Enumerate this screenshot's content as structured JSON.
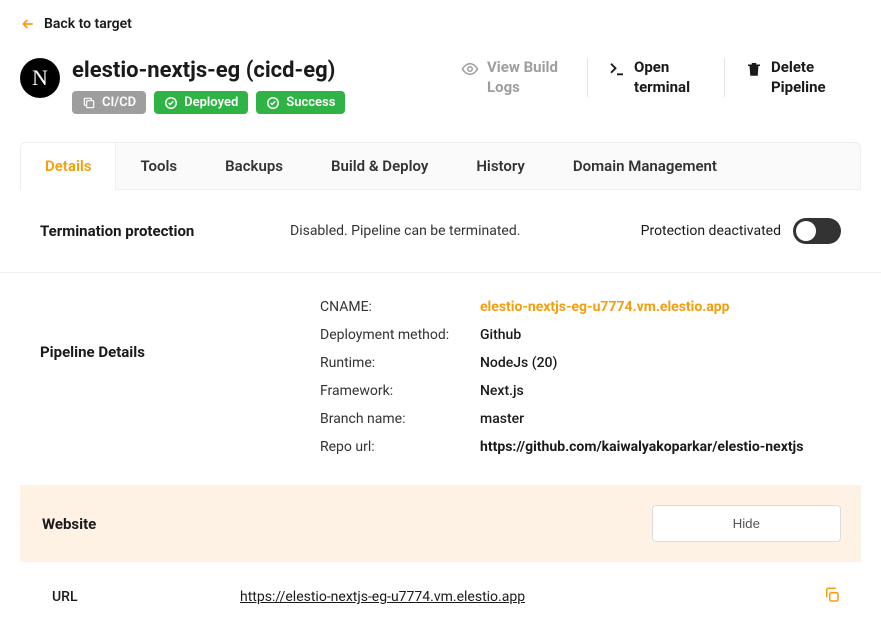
{
  "back_label": "Back to target",
  "header": {
    "logo_letter": "N",
    "title": "elestio-nextjs-eg (cicd-eg)",
    "badges": {
      "cicd": "CI/CD",
      "deployed": "Deployed",
      "success": "Success"
    },
    "actions": {
      "view_logs": "View Build Logs",
      "terminal": "Open terminal",
      "delete": "Delete Pipeline"
    }
  },
  "tabs": [
    "Details",
    "Tools",
    "Backups",
    "Build & Deploy",
    "History",
    "Domain Management"
  ],
  "termination": {
    "label": "Termination protection",
    "desc": "Disabled. Pipeline can be terminated.",
    "status": "Protection deactivated"
  },
  "pipeline": {
    "label": "Pipeline Details",
    "rows": [
      {
        "key": "CNAME:",
        "val": "elestio-nextjs-eg-u7774.vm.elestio.app",
        "accent": true
      },
      {
        "key": "Deployment method:",
        "val": "Github"
      },
      {
        "key": "Runtime:",
        "val": "NodeJs (20)"
      },
      {
        "key": "Framework:",
        "val": "Next.js"
      },
      {
        "key": "Branch name:",
        "val": "master"
      },
      {
        "key": "Repo url:",
        "val": "https://github.com/kaiwalyakoparkar/elestio-nextjs",
        "bold": true
      }
    ]
  },
  "website": {
    "label": "Website",
    "hide": "Hide"
  },
  "url": {
    "label": "URL",
    "val": "https://elestio-nextjs-eg-u7774.vm.elestio.app"
  }
}
